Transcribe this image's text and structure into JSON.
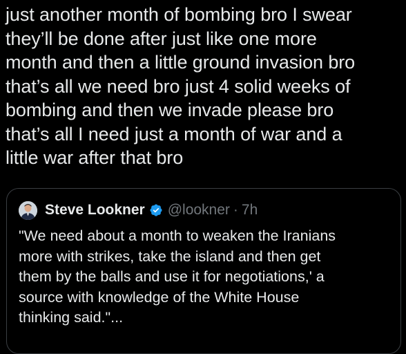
{
  "tweet": {
    "text": "just another month of bombing bro I swear\nthey’ll be done after just like one more\nmonth and then a little ground invasion bro\nthat’s all we need bro just 4 solid weeks of\nbombing and then we invade please bro\nthat’s all I need just a month of war and a\nlittle war after that bro"
  },
  "quoted_tweet": {
    "author_name": "Steve Lookner",
    "handle": "@lookner",
    "separator": "·",
    "time_ago": "7h",
    "verified": true,
    "avatar_icon": "avatar-icon",
    "badge_icon": "verified-badge-icon",
    "text": "\"We need about a month to weaken the Iranians\nmore with strikes, take the island and then get\nthem by the balls and use it for negotiations,' a\nsource with knowledge of the White House\nthinking said.\"..."
  },
  "colors": {
    "background": "#000000",
    "text_primary": "#e7e9ea",
    "text_secondary": "#71767b",
    "border": "#3b3f43",
    "verified_blue": "#1d9bf0"
  }
}
